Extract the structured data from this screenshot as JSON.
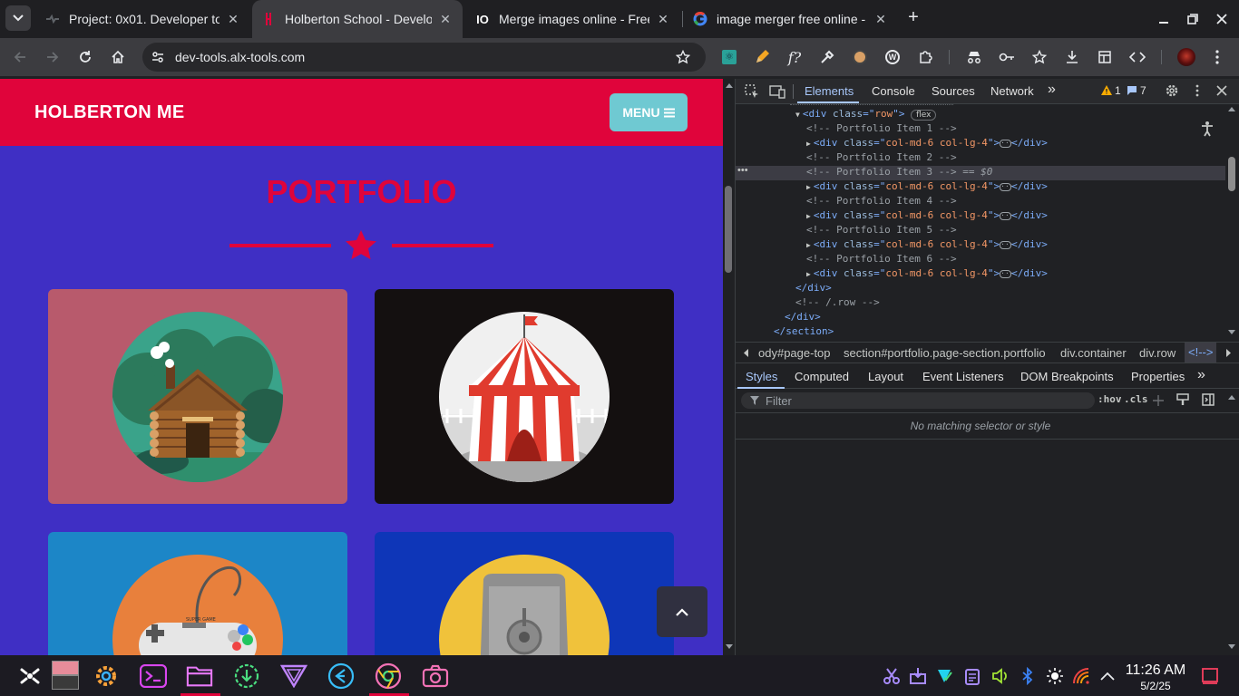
{
  "tabs": [
    {
      "title": "Project: 0x01. Developer to",
      "close": "✕"
    },
    {
      "title": "Holberton School - Develop",
      "close": "✕",
      "active": true
    },
    {
      "title": "Merge images online - Free",
      "close": "✕"
    },
    {
      "title": "image merger free online -",
      "close": "✕"
    }
  ],
  "new_tab": "+",
  "address": {
    "url": "dev-tools.alx-tools.com"
  },
  "page": {
    "brand": "HOLBERTON ME",
    "menu_label": "MENU",
    "section_title": "PORTFOLIO",
    "colors": {
      "primary": "#e0043b",
      "background": "#3f2fc4",
      "menu": "#6fc9d2"
    },
    "cards": [
      {
        "name": "cabin",
        "bg": "#b85a6c"
      },
      {
        "name": "circus-tent",
        "bg": "#141010"
      },
      {
        "name": "game-controller",
        "bg": "#1c86c7"
      },
      {
        "name": "safe",
        "bg": "#0e36b8"
      }
    ]
  },
  "devtools": {
    "tabs": [
      "Elements",
      "Console",
      "Sources",
      "Network"
    ],
    "more": "»",
    "warnings": "1",
    "messages": "7",
    "flex_badge": "flex",
    "selected_marker": "== $0",
    "lines": [
      {
        "indent": 0,
        "kind": "open",
        "tag": "div",
        "attr": "class",
        "val": "row",
        "expanded": true
      },
      {
        "indent": 1,
        "kind": "comment",
        "text": "<!-- Portfolio Item 1 -->"
      },
      {
        "indent": 1,
        "kind": "collapsed",
        "tag": "div",
        "attr": "class",
        "val": "col-md-6 col-lg-4"
      },
      {
        "indent": 1,
        "kind": "comment",
        "text": "<!-- Portfolio Item 2 -->"
      },
      {
        "indent": 1,
        "kind": "comment",
        "text": "<!-- Portfolio Item 3 -->",
        "selected": true
      },
      {
        "indent": 1,
        "kind": "collapsed",
        "tag": "div",
        "attr": "class",
        "val": "col-md-6 col-lg-4"
      },
      {
        "indent": 1,
        "kind": "comment",
        "text": "<!-- Portfolio Item 4 -->"
      },
      {
        "indent": 1,
        "kind": "collapsed",
        "tag": "div",
        "attr": "class",
        "val": "col-md-6 col-lg-4"
      },
      {
        "indent": 1,
        "kind": "comment",
        "text": "<!-- Portfolio Item 5 -->"
      },
      {
        "indent": 1,
        "kind": "collapsed",
        "tag": "div",
        "attr": "class",
        "val": "col-md-6 col-lg-4"
      },
      {
        "indent": 1,
        "kind": "comment",
        "text": "<!-- Portfolio Item 6 -->"
      },
      {
        "indent": 1,
        "kind": "collapsed",
        "tag": "div",
        "attr": "class",
        "val": "col-md-6 col-lg-4"
      },
      {
        "indent": 0,
        "kind": "close",
        "text": "</div>"
      },
      {
        "indent": 0,
        "kind": "comment",
        "text": "<!-- /.row -->"
      },
      {
        "indent": -1,
        "kind": "close",
        "text": "</div>"
      },
      {
        "indent": -2,
        "kind": "close",
        "text": "</section>"
      }
    ],
    "breadcrumbs": [
      "ody#page-top",
      "section#portfolio.page-section.portfolio",
      "div.container",
      "div.row",
      "<!-->"
    ],
    "subtabs": [
      "Styles",
      "Computed",
      "Layout",
      "Event Listeners",
      "DOM Breakpoints",
      "Properties"
    ],
    "filter_placeholder": "Filter",
    "hov": ":hov",
    "cls": ".cls",
    "empty_msg": "No matching selector or style"
  },
  "taskbar": {
    "time": "11:26 AM",
    "date": "5/2/25"
  }
}
